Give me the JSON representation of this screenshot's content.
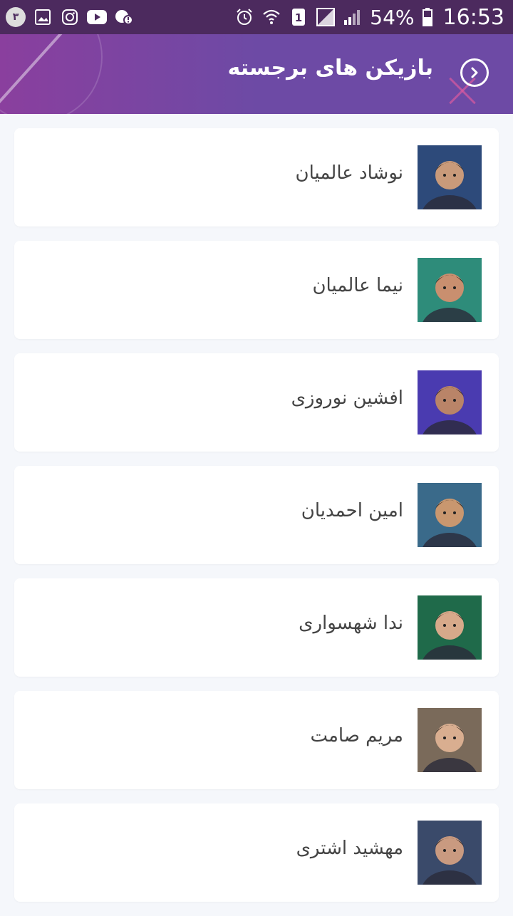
{
  "status_bar": {
    "notification_badge": "۳",
    "battery": "54%",
    "time": "16:53",
    "sim": "1",
    "icons_left": [
      "notification-badge",
      "image-icon",
      "instagram-icon",
      "youtube-icon",
      "messenger-alert-icon"
    ],
    "icons_right": [
      "alarm-icon",
      "wifi-icon",
      "sim1-icon",
      "no-signal-icon",
      "signal-icon",
      "battery-icon"
    ]
  },
  "header": {
    "title": "بازیکن های برجسته",
    "back_icon": "chevron-right-circle-icon",
    "gradient_start": "#8a3f9e",
    "gradient_end": "#6d4aa5"
  },
  "players": [
    {
      "name": "نوشاد عالمیان",
      "photo_bg": "#2d4a7a",
      "skin": "#c99a7a"
    },
    {
      "name": "نیما عالمیان",
      "photo_bg": "#2e8c7a",
      "skin": "#c98f6f"
    },
    {
      "name": "افشین نوروزی",
      "photo_bg": "#4a3bb0",
      "skin": "#b98468"
    },
    {
      "name": "امین احمدیان",
      "photo_bg": "#3a6a8a",
      "skin": "#c9976f"
    },
    {
      "name": "ندا شهسواری",
      "photo_bg": "#1f6a4a",
      "skin": "#d7a98a"
    },
    {
      "name": "مریم صامت",
      "photo_bg": "#7a6a5a",
      "skin": "#d9ae90"
    },
    {
      "name": "مهشید اشتری",
      "photo_bg": "#3a4a6a",
      "skin": "#c99a80"
    }
  ]
}
